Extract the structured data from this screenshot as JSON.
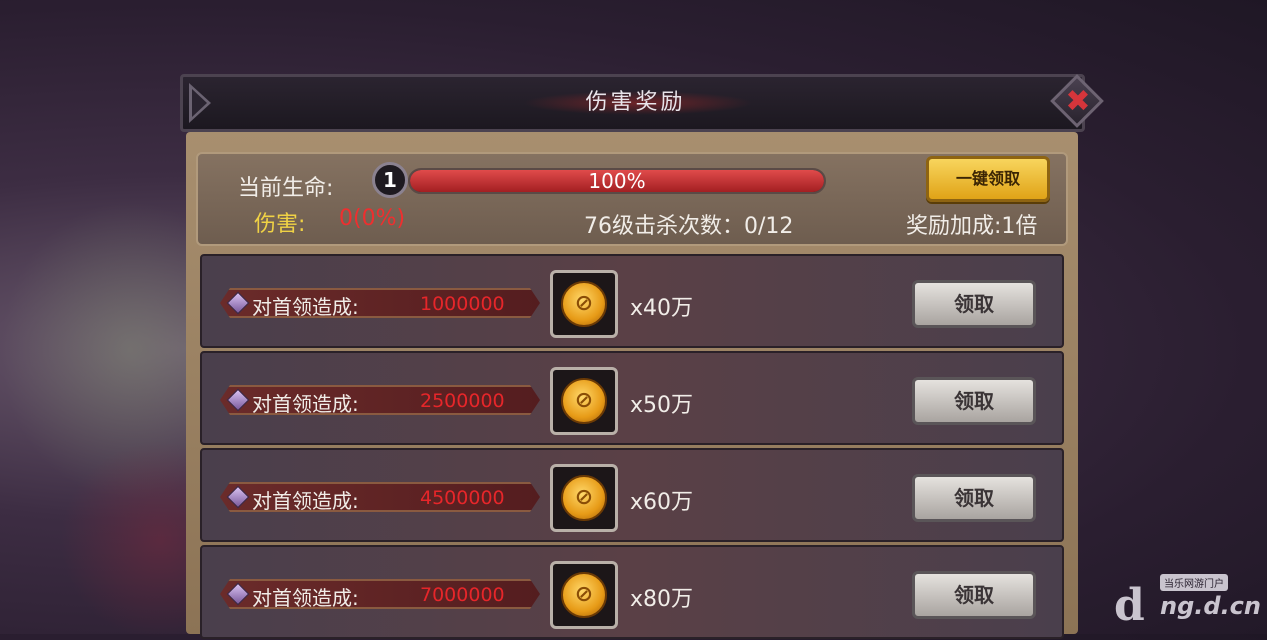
{
  "window": {
    "title": "伤害奖励"
  },
  "info": {
    "hp_label": "当前生命:",
    "hp_layers": "1",
    "hp_percent_text": "100%",
    "hp_fraction": 1.0,
    "damage_label": "伤害:",
    "damage_value": "0(0%)",
    "kills": "76级击杀次数：0/12",
    "claim_all_label": "一键领取",
    "bonus": "奖励加成:1倍"
  },
  "rewards": [
    {
      "label": "对首领造成:",
      "value": "1000000",
      "amount": "x40万",
      "button": "领取"
    },
    {
      "label": "对首领造成:",
      "value": "2500000",
      "amount": "x50万",
      "button": "领取"
    },
    {
      "label": "对首领造成:",
      "value": "4500000",
      "amount": "x60万",
      "button": "领取"
    },
    {
      "label": "对首领造成:",
      "value": "7000000",
      "amount": "x80万",
      "button": "领取"
    }
  ],
  "icons": {
    "close": "close-icon",
    "coin": "gold-coin-icon",
    "gem": "gem-icon",
    "arrow": "arrow-icon"
  },
  "watermark": {
    "tag": "当乐网游门户",
    "site": "ng.d.cn"
  },
  "colors": {
    "hp_bar": "#c5302f",
    "damage_label": "#f0d245",
    "damage_value": "#ee2f2f",
    "reward_value": "#e6262a",
    "claim_all": "#f0b82a"
  }
}
